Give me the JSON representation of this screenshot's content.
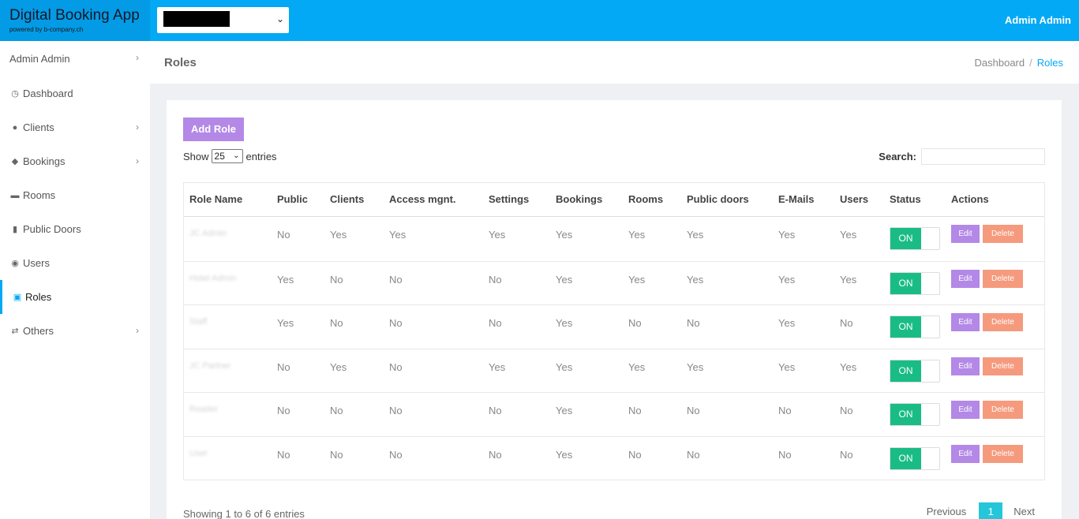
{
  "brand": {
    "title": "Digital Booking App",
    "subtitle": "powered by b-company.ch"
  },
  "topbar": {
    "user": "Admin Admin"
  },
  "sidebar": {
    "items": [
      {
        "label": "Admin Admin"
      },
      {
        "label": "Dashboard"
      },
      {
        "label": "Clients"
      },
      {
        "label": "Bookings"
      },
      {
        "label": "Rooms"
      },
      {
        "label": "Public Doors"
      },
      {
        "label": "Users"
      },
      {
        "label": "Roles"
      },
      {
        "label": "Others"
      }
    ]
  },
  "page": {
    "title": "Roles"
  },
  "breadcrumb": {
    "home": "Dashboard",
    "sep": "/",
    "current": "Roles"
  },
  "toolbar": {
    "add_label": "Add Role"
  },
  "length": {
    "show": "Show",
    "value": "25",
    "entries": "entries"
  },
  "search": {
    "label": "Search:"
  },
  "table": {
    "headers": [
      "Role Name",
      "Public",
      "Clients",
      "Access mgnt.",
      "Settings",
      "Bookings",
      "Rooms",
      "Public doors",
      "E-Mails",
      "Users",
      "Status",
      "Actions"
    ],
    "rows": [
      {
        "name": "JC Admin",
        "cells": [
          "No",
          "Yes",
          "Yes",
          "Yes",
          "Yes",
          "Yes",
          "Yes",
          "Yes",
          "Yes"
        ],
        "status": "ON",
        "edit": "Edit",
        "delete": "Delete"
      },
      {
        "name": "Hotel Admin",
        "cells": [
          "Yes",
          "No",
          "No",
          "No",
          "Yes",
          "Yes",
          "Yes",
          "Yes",
          "Yes"
        ],
        "status": "ON",
        "edit": "Edit",
        "delete": "Delete"
      },
      {
        "name": "Staff",
        "cells": [
          "Yes",
          "No",
          "No",
          "No",
          "Yes",
          "No",
          "No",
          "Yes",
          "No"
        ],
        "status": "ON",
        "edit": "Edit",
        "delete": "Delete"
      },
      {
        "name": "JC Partner",
        "cells": [
          "No",
          "Yes",
          "No",
          "Yes",
          "Yes",
          "Yes",
          "Yes",
          "Yes",
          "Yes"
        ],
        "status": "ON",
        "edit": "Edit",
        "delete": "Delete"
      },
      {
        "name": "Reader",
        "cells": [
          "No",
          "No",
          "No",
          "No",
          "Yes",
          "No",
          "No",
          "No",
          "No"
        ],
        "status": "ON",
        "edit": "Edit",
        "delete": "Delete"
      },
      {
        "name": "User",
        "cells": [
          "No",
          "No",
          "No",
          "No",
          "Yes",
          "No",
          "No",
          "No",
          "No"
        ],
        "status": "ON",
        "edit": "Edit",
        "delete": "Delete"
      }
    ]
  },
  "footer": {
    "info": "Showing 1 to 6 of 6 entries",
    "previous": "Previous",
    "page": "1",
    "next": "Next"
  },
  "colors": {
    "topbar": "#03a9f4",
    "accent_purple": "#b388e6",
    "delete_orange": "#f59a7d",
    "toggle_green": "#1abc85",
    "page_active": "#26c6da"
  }
}
